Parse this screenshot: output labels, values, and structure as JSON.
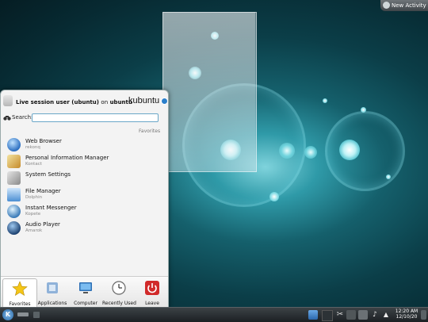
{
  "activity": {
    "label": "New Activity"
  },
  "menu": {
    "user_name": "Live session user (ubuntu)",
    "user_on": "on",
    "host": "ubuntu",
    "brand": "kubuntu",
    "search_label": "Search:",
    "search_value": "",
    "section_title": "Favorites",
    "items": [
      {
        "name": "Web Browser",
        "sub": "rekonq",
        "icon": "globe-icon"
      },
      {
        "name": "Personal Information Manager",
        "sub": "Kontact",
        "icon": "kontact-icon"
      },
      {
        "name": "System Settings",
        "sub": "",
        "icon": "settings-icon"
      },
      {
        "name": "File Manager",
        "sub": "Dolphin",
        "icon": "folder-icon"
      },
      {
        "name": "Instant Messenger",
        "sub": "Kopete",
        "icon": "chat-icon"
      },
      {
        "name": "Audio Player",
        "sub": "Amarok",
        "icon": "amarok-icon"
      }
    ],
    "tabs": [
      {
        "label": "Favorites",
        "icon": "star-icon"
      },
      {
        "label": "Applications",
        "icon": "applications-icon"
      },
      {
        "label": "Computer",
        "icon": "computer-icon"
      },
      {
        "label": "Recently Used",
        "icon": "clock-icon"
      },
      {
        "label": "Leave",
        "icon": "power-icon"
      }
    ]
  },
  "taskbar": {
    "start_label": "K",
    "clock_time": "12:20 AM",
    "clock_date": "12/10/20"
  },
  "colors": {
    "accent": "#2b7fcb",
    "leave": "#d12a2a",
    "desktop": "#0b3e48"
  }
}
